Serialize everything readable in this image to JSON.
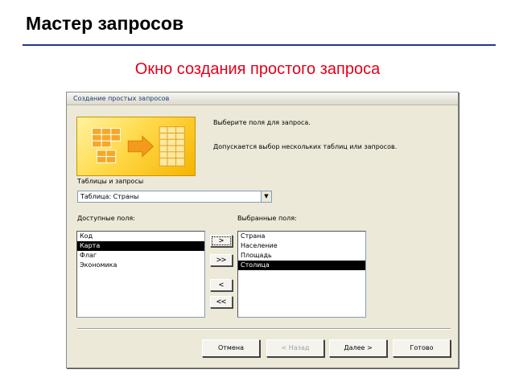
{
  "slide": {
    "title": "Мастер запросов",
    "subtitle": "Окно создания простого запроса"
  },
  "dialog": {
    "title": "Создание простых запросов",
    "banner_icon": "table-to-table-icon",
    "instruction_1": "Выберите поля для запроса.",
    "instruction_2": "Допускается выбор нескольких таблиц или запросов.",
    "tables_label": "Таблицы и запросы",
    "tables_selected": "Таблица: Страны",
    "available_label": "Доступные поля:",
    "available_fields": [
      "Код",
      "Карта",
      "Флаг",
      "Экономика"
    ],
    "available_selected_index": 1,
    "chosen_label": "Выбранные поля:",
    "chosen_fields": [
      "Страна",
      "Население",
      "Площадь",
      "Столица"
    ],
    "chosen_selected_index": 3,
    "move_buttons": {
      "add_one": ">",
      "add_all": ">>",
      "remove_one": "<",
      "remove_all": "<<"
    },
    "buttons": {
      "cancel": "Отмена",
      "back": "< Назад",
      "next": "Далее >",
      "finish": "Готово"
    }
  },
  "colors": {
    "rule": "#1f3a8a",
    "subtitle": "#e0001b",
    "dialog_bg": "#ece9d8",
    "selection": "#000000"
  }
}
